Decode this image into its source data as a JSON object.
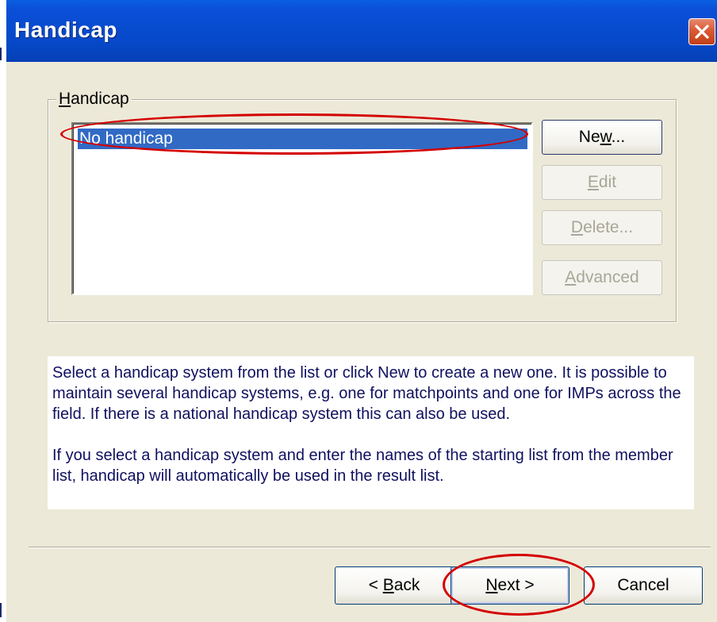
{
  "window": {
    "title": "Handicap"
  },
  "group": {
    "label": "Handicap",
    "list_items": [
      "No handicap"
    ],
    "selected_index": 0
  },
  "buttons": {
    "new": "New...",
    "edit": "Edit",
    "delete": "Delete...",
    "advanced": "Advanced"
  },
  "info": {
    "paragraph1": "Select a handicap system from the list or click New to create a new one. It is possible to maintain several handicap systems, e.g. one for matchpoints and one for IMPs across the field. If there is a national handicap system this can also be used.",
    "paragraph2": "If you select a handicap system and enter the names of the starting list from the member list, handicap will automatically be used in the result list."
  },
  "footer": {
    "back": "< Back",
    "next": "Next >",
    "cancel": "Cancel"
  },
  "colors": {
    "titlebar": "#0648c8",
    "selection": "#316ac5",
    "annotation": "#d40000",
    "dialog_bg": "#ece9d8"
  }
}
